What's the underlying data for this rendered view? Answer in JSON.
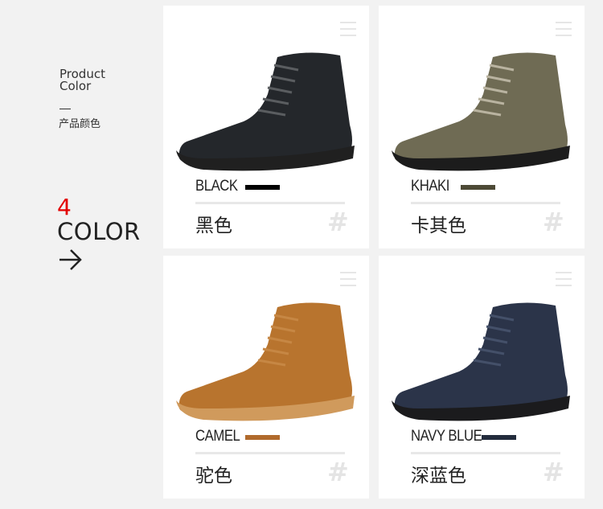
{
  "sidebar": {
    "product_color_en": "Product Color",
    "dash": "—",
    "product_color_cn": "产品颜色",
    "count": "4",
    "color_word": "COLOR"
  },
  "products": [
    {
      "name_en": "BLACK",
      "name_cn": "黑色",
      "swatch": "#000000",
      "body": "#24272b",
      "sole": "#202020",
      "lace": "#5a5d60"
    },
    {
      "name_en": "KHAKI",
      "name_cn": "卡其色",
      "swatch": "#4d4a36",
      "body": "#6f6b54",
      "sole": "#1c1c1c",
      "lace": "#b9b3a0"
    },
    {
      "name_en": "CAMEL",
      "name_cn": "驼色",
      "swatch": "#b06a2c",
      "body": "#b8742e",
      "sole": "#d09a5c",
      "lace": "#c68744"
    },
    {
      "name_en": "NAVY BLUE",
      "name_cn": "深蓝色",
      "swatch": "#232c3d",
      "body": "#2b3449",
      "sole": "#1b1b1d",
      "lace": "#445069"
    }
  ],
  "hash_symbol": "#"
}
